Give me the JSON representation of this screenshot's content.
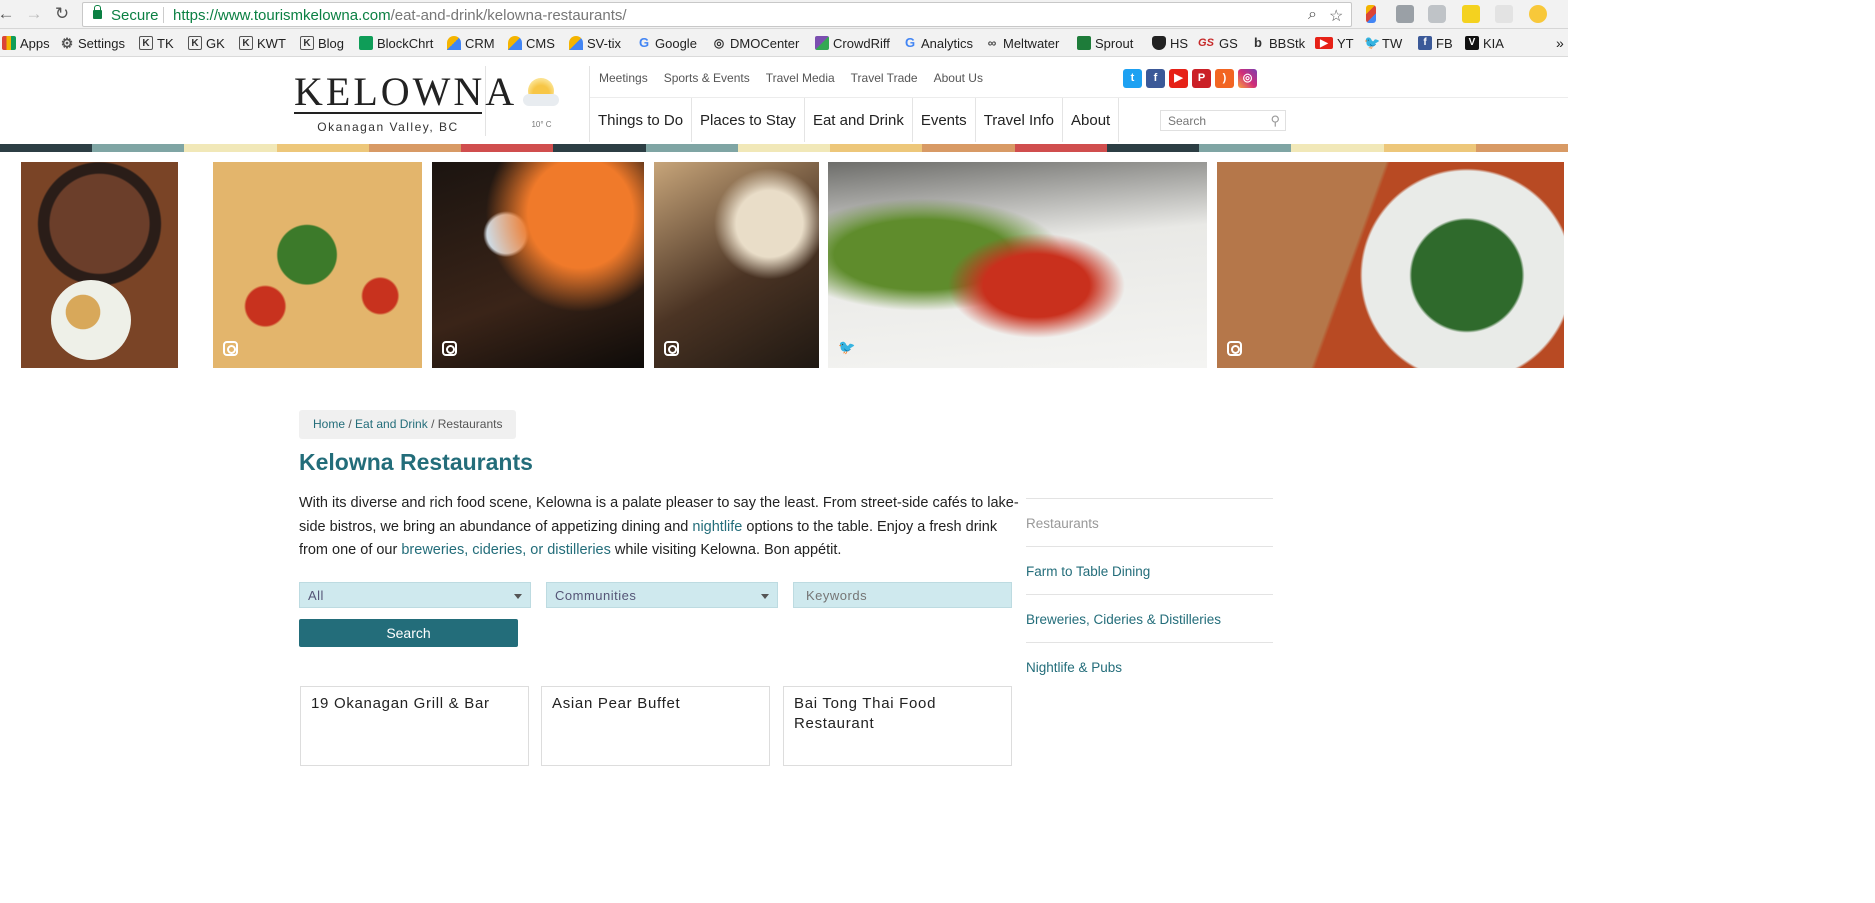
{
  "browser": {
    "secure_label": "Secure",
    "url_host": "https://www.tourismkelowna.com",
    "url_path": "/eat-and-drink/kelowna-restaurants/",
    "bookmarks": [
      "Apps",
      "Settings",
      "TK",
      "GK",
      "KWT",
      "Blog",
      "BlockChrt",
      "CRM",
      "CMS",
      "SV-tix",
      "Google",
      "DMOCenter",
      "CrowdRiff",
      "Analytics",
      "Meltwater",
      "Sprout",
      "HS",
      "GS",
      "BBStk",
      "YT",
      "TW",
      "FB",
      "KIA"
    ],
    "bookmarks_overflow": "»"
  },
  "header": {
    "logo_text": "KELOWNA",
    "logo_sub": "Okanagan Valley, BC",
    "weather_temp": "10° C",
    "top_links": [
      "Meetings",
      "Sports & Events",
      "Travel Media",
      "Travel Trade",
      "About Us"
    ],
    "main_nav": [
      "Things to Do",
      "Places to Stay",
      "Eat and Drink",
      "Events",
      "Travel Info",
      "About"
    ],
    "search_placeholder": "Search"
  },
  "breadcrumb": {
    "home": "Home",
    "sep": " / ",
    "eat": "Eat and Drink",
    "current": "Restaurants"
  },
  "page_title": "Kelowna Restaurants",
  "intro": {
    "t1": "With its diverse and rich food scene, Kelowna is a palate pleaser to say the least. From street-side cafés to lake-side bistros, we bring an abundance of appetizing dining and ",
    "link1": "nightlife",
    "t2": " options to the table. Enjoy a fresh drink from one of our ",
    "link2": "breweries, cideries, or distilleries",
    "t3": " while visiting Kelowna. Bon appétit."
  },
  "filters": {
    "category": "All",
    "communities": "Communities",
    "keywords_placeholder": "Keywords",
    "search_label": "Search"
  },
  "results": [
    "19 Okanagan Grill & Bar",
    "Asian Pear Buffet",
    "Bai Tong Thai Food Restaurant"
  ],
  "sidebar": [
    "Restaurants",
    "Farm to Table Dining",
    "Breweries, Cideries & Distilleries",
    "Nightlife & Pubs"
  ],
  "colors": {
    "accent": "#236d7a",
    "stripe": [
      "#2c3e44",
      "#7fa5a4",
      "#f1e8b8",
      "#edc77a",
      "#d89a65",
      "#d04e4e"
    ]
  }
}
